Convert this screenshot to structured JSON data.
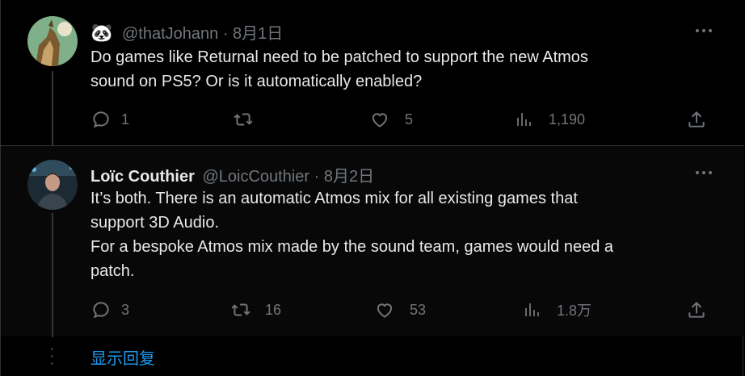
{
  "tweets": [
    {
      "emoji": "🐼",
      "name": "",
      "handle": "@thatJohann",
      "date": "8月1日",
      "sep": "·",
      "text": [
        "Do games like Returnal need to be patched to support the new Atmos",
        "sound on PS5? Or is it automatically enabled?"
      ],
      "replies": "1",
      "retweets": "",
      "likes": "5",
      "views": "1,190"
    },
    {
      "name": "Loïc Couthier",
      "handle": "@LoicCouthier",
      "date": "8月2日",
      "sep": "·",
      "text": [
        "It’s both. There is an automatic Atmos mix for all existing games that",
        "support 3D Audio.",
        "For a bespoke Atmos mix made by the sound team, games would need a",
        "patch."
      ],
      "replies": "3",
      "retweets": "16",
      "likes": "53",
      "views": "1.8万"
    }
  ],
  "show_replies": "显示回复",
  "colors": {
    "accent": "#1d9bf0",
    "muted": "#71767b",
    "text": "#e7e9ea"
  },
  "icons": [
    "reply-icon",
    "retweet-icon",
    "like-icon",
    "views-icon",
    "share-icon",
    "more-icon"
  ]
}
